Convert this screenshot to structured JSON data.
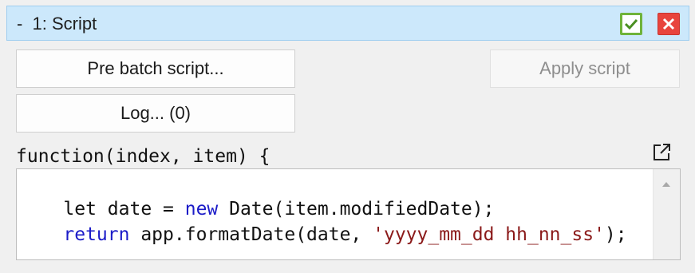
{
  "header": {
    "title": "-  1: Script",
    "confirm_icon": "check-icon",
    "close_icon": "close-icon",
    "colors": {
      "background": "#cce8fb",
      "confirm": "#6fb33a",
      "close": "#e8443d"
    }
  },
  "buttons": {
    "pre_batch": "Pre batch script...",
    "apply": "Apply script",
    "log": "Log... (0)"
  },
  "editor": {
    "signature": "function(index, item) {",
    "expand_icon": "external-link-icon",
    "lines": [
      {
        "tokens": [
          {
            "text": "let date = ",
            "type": "plain"
          },
          {
            "text": "new",
            "type": "keyword"
          },
          {
            "text": " Date(item.modifiedDate);",
            "type": "plain"
          }
        ]
      },
      {
        "tokens": [
          {
            "text": "return",
            "type": "keyword"
          },
          {
            "text": " app.formatDate(date, ",
            "type": "plain"
          },
          {
            "text": "'yyyy_mm_dd hh_nn_ss'",
            "type": "string"
          },
          {
            "text": ");",
            "type": "plain"
          }
        ]
      }
    ],
    "colors": {
      "keyword": "#1c1cc8",
      "string": "#8b1a1a"
    }
  }
}
